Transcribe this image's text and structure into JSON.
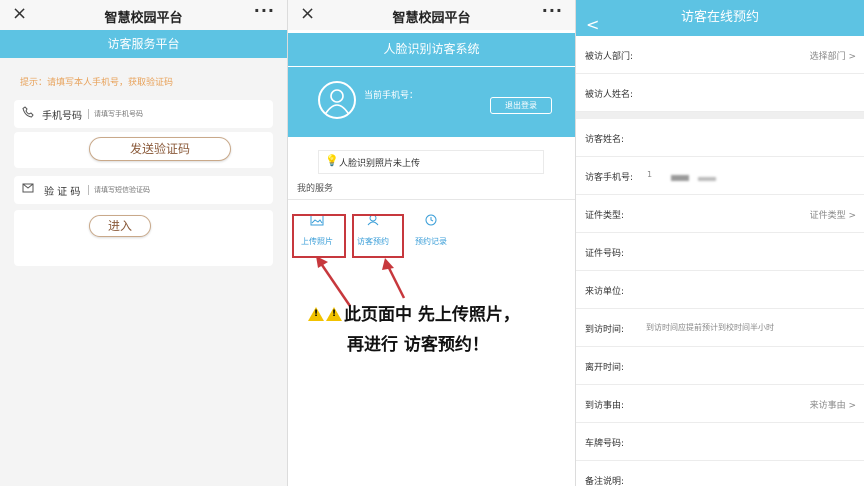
{
  "panel1": {
    "topbar": {
      "close": "×",
      "title": "智慧校园平台",
      "more": "···"
    },
    "subtitle": "访客服务平台",
    "hint": "提示：请填写本人手机号，获取验证码",
    "phone_row": {
      "label": "手机号码",
      "placeholder": "请填写手机号码",
      "icon": "phone-icon"
    },
    "send_code_label": "发送验证码",
    "code_row": {
      "label": "验 证 码",
      "placeholder": "请填写短信验证码",
      "icon": "message-icon"
    },
    "enter_label": "进入"
  },
  "panel2": {
    "topbar": {
      "close": "×",
      "title": "智慧校园平台",
      "more": "···"
    },
    "subtitle": "人脸识别访客系统",
    "profile": {
      "phone_label": "当前手机号：",
      "logout_label": "退出登录",
      "avatar_icon": "user-avatar-icon"
    },
    "notice": {
      "icon": "💡",
      "text": "人脸识别照片未上传"
    },
    "services_label": "我的服务",
    "services": [
      {
        "label": "上传照片",
        "icon": "image-icon"
      },
      {
        "label": "访客预约",
        "icon": "visitor-icon"
      },
      {
        "label": "预约记录",
        "icon": "clock-icon"
      }
    ],
    "annotation": {
      "line1": "此页面中 先上传照片，",
      "line2": "再进行 访客预约！",
      "warning_glyph": "!"
    }
  },
  "panel3": {
    "header": {
      "back": "<",
      "title": "访客在线预约"
    },
    "fields": [
      {
        "label": "被访人部门:",
        "right": "选择部门 >"
      },
      {
        "label": "被访人姓名:",
        "right": ""
      },
      {
        "label": "访客姓名:",
        "right": ""
      },
      {
        "label": "访客手机号:",
        "value": "1",
        "right": ""
      },
      {
        "label": "证件类型:",
        "right": "证件类型 >"
      },
      {
        "label": "证件号码:",
        "right": ""
      },
      {
        "label": "来访单位:",
        "right": ""
      },
      {
        "label": "到访时间:",
        "middle": "到访时间应提前预计到校时间半小时"
      },
      {
        "label": "离开时间:",
        "right": ""
      },
      {
        "label": "到访事由:",
        "right": "来访事由 >"
      },
      {
        "label": "车牌号码:",
        "right": ""
      },
      {
        "label": "备注说明:",
        "right": ""
      }
    ]
  },
  "colors": {
    "accent_blue": "#5dc3e3",
    "annotation_red": "#c7383d",
    "hint_orange": "#e8a25a"
  }
}
